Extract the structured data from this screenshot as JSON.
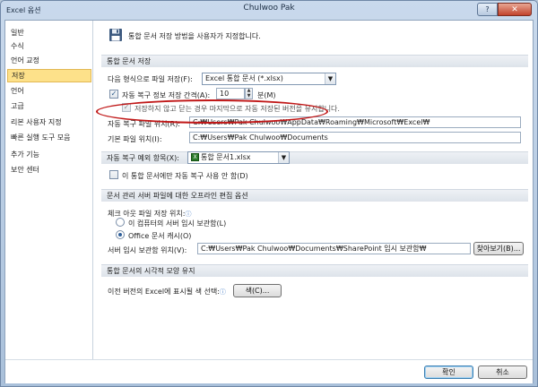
{
  "window": {
    "app_label": "Excel 옵션",
    "title": "Chulwoo Pak",
    "help_glyph": "?",
    "close_glyph": "✕"
  },
  "sidebar": {
    "items": [
      {
        "label": "일반"
      },
      {
        "label": "수식"
      },
      {
        "label": "언어 교정"
      },
      {
        "label": "저장",
        "active": true
      },
      {
        "label": "언어"
      },
      {
        "label": "고급"
      },
      {
        "label": "리본 사용자 지정"
      },
      {
        "label": "빠른 실행 도구 모음"
      },
      {
        "label": "추가 기능"
      },
      {
        "label": "보안 센터"
      }
    ]
  },
  "header": {
    "text": "통합 문서 저장 방법을 사용자가 지정합니다.",
    "icon": "floppy-disk-icon"
  },
  "save_section": {
    "title": "통합 문서 저장",
    "format_label": "다음 형식으로 파일 저장(F):",
    "format_value": "Excel 통합 문서 (*.xlsx)",
    "autorecover_label": "자동 복구 정보 저장 간격(A):",
    "autorecover_value": "10",
    "minutes_label": "분(M)",
    "keep_last_label": "저장하지 않고 닫는 경우 마지막으로 자동 저장된 버전을 유지합니다.",
    "autorecover_path_label": "자동 복구 파일 위치(R):",
    "autorecover_path": "C:₩Users₩Pak Chulwoo₩AppData₩Roaming₩Microsoft₩Excel₩",
    "default_path_label": "기본 파일 위치(I):",
    "default_path": "C:₩Users₩Pak Chulwoo₩Documents"
  },
  "exceptions_section": {
    "label": "자동 복구 예외 항목(X):",
    "workbook": "통합 문서1.xlsx",
    "disable_label": "이 통합 문서에만 자동 복구 사용 안 함(D)"
  },
  "offline_section": {
    "title": "문서 관리 서버 파일에 대한 오프라인 편집 옵션",
    "checkout_label": "체크 아웃 파일 저장 위치:",
    "radio_server": "이 컴퓨터의 서버 임시 보관함(L)",
    "radio_cache": "Office 문서 캐시(O)",
    "drafts_label": "서버 임시 보관함 위치(V):",
    "drafts_path": "C:₩Users₩Pak Chulwoo₩Documents₩SharePoint 임시 보관함₩",
    "browse_label": "찾아보기(B)..."
  },
  "appearance_section": {
    "title": "통합 문서의 시각적 모양 유지",
    "colors_label": "이전 버전의 Excel에 표시될 색 선택:",
    "colors_button": "색(C)..."
  },
  "footer": {
    "ok_label": "확인",
    "cancel_label": "취소"
  },
  "colors": {
    "accent_ring": "#c01717",
    "selected_item": "#fde18a"
  }
}
